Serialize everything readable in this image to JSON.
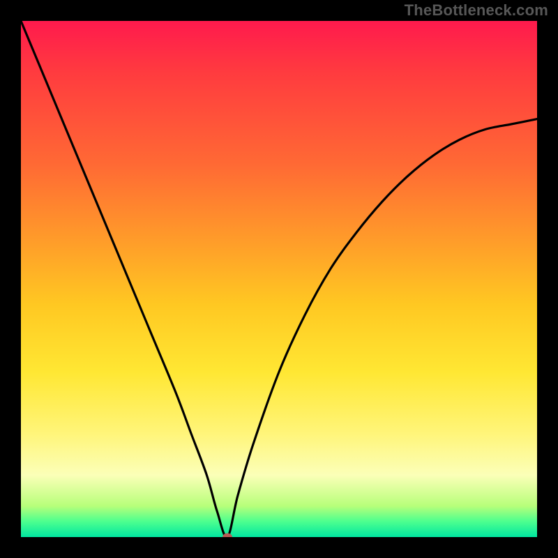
{
  "watermark": "TheBottleneck.com",
  "colors": {
    "page_bg": "#000000",
    "curve": "#000000",
    "marker": "#b85b55",
    "gradient_stops": [
      "#ff1a4d",
      "#ff3b3f",
      "#ff6a34",
      "#ff9a2a",
      "#ffc822",
      "#ffe733",
      "#fff57a",
      "#fbffb8",
      "#b7ff7a",
      "#4cff8f",
      "#00e6a0"
    ]
  },
  "chart_data": {
    "type": "line",
    "title": "",
    "xlabel": "",
    "ylabel": "",
    "xlim": [
      0,
      100
    ],
    "ylim": [
      0,
      100
    ],
    "marker": {
      "x": 40,
      "y": 0
    },
    "series": [
      {
        "name": "bottleneck-curve",
        "x": [
          0,
          5,
          10,
          15,
          20,
          25,
          30,
          33,
          36,
          38,
          40,
          42,
          45,
          50,
          55,
          60,
          65,
          70,
          75,
          80,
          85,
          90,
          95,
          100
        ],
        "y": [
          100,
          88,
          76,
          64,
          52,
          40,
          28,
          20,
          12,
          5,
          0,
          8,
          18,
          32,
          43,
          52,
          59,
          65,
          70,
          74,
          77,
          79,
          80,
          81
        ]
      }
    ],
    "annotations": [],
    "grid": false,
    "legend": false
  }
}
